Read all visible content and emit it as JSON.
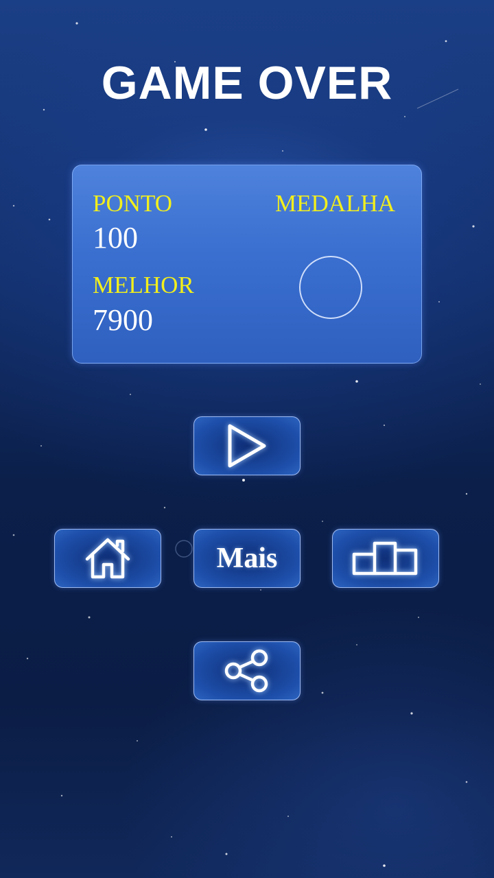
{
  "title": "GAME OVER",
  "score_panel": {
    "score_label": "PONTO",
    "score_value": "100",
    "best_label": "MELHOR",
    "best_value": "7900",
    "medal_label": "MEDALHA"
  },
  "buttons": {
    "play_icon": "play-icon",
    "home_icon": "home-icon",
    "more_label": "Mais",
    "leaderboard_icon": "podium-icon",
    "share_icon": "share-icon"
  },
  "colors": {
    "label_yellow": "#f2ef1c",
    "panel_blue": "#3a6fd0",
    "text_white": "#ffffff"
  }
}
